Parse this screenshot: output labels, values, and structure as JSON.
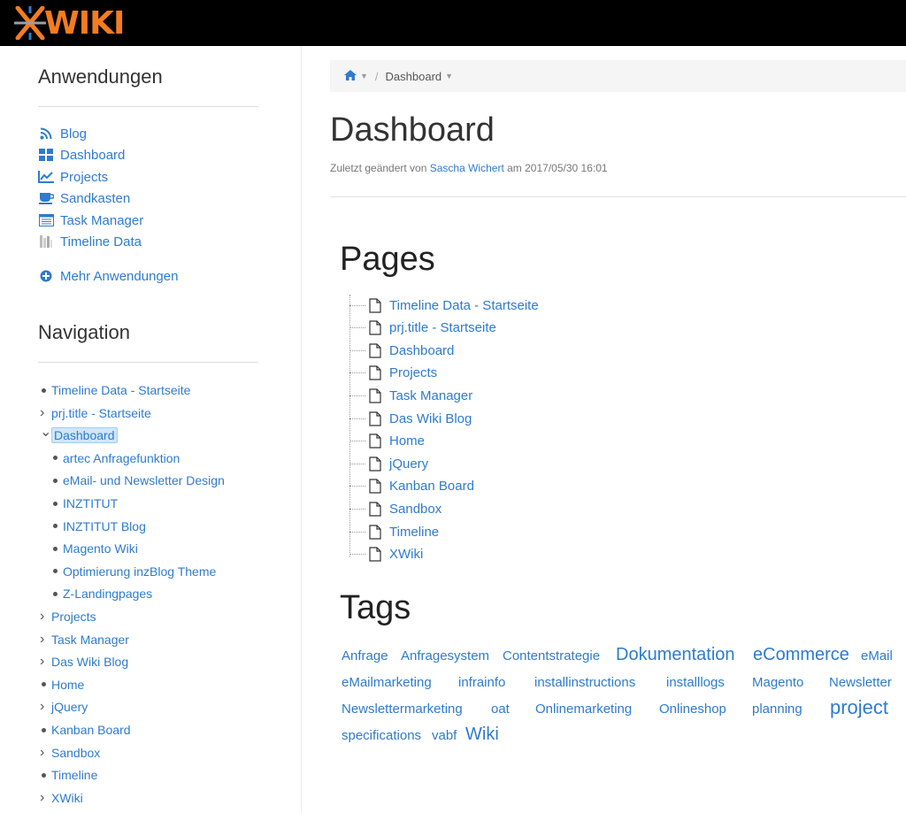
{
  "header": {
    "logo_text": "WIKI",
    "brand_color": "#f47c20"
  },
  "applications": {
    "title": "Anwendungen",
    "items": [
      {
        "label": "Blog",
        "icon": "rss-icon"
      },
      {
        "label": "Dashboard",
        "icon": "grid-icon"
      },
      {
        "label": "Projects",
        "icon": "line-chart-icon"
      },
      {
        "label": "Sandkasten",
        "icon": "coffee-cup-icon"
      },
      {
        "label": "Task Manager",
        "icon": "list-icon"
      },
      {
        "label": "Timeline Data",
        "icon": "timeline-icon"
      }
    ],
    "more_label": "Mehr Anwendungen"
  },
  "navigation": {
    "title": "Navigation",
    "items": [
      {
        "label": "Timeline Data - Startseite",
        "marker": "bullet",
        "level": 0
      },
      {
        "label": "prj.title - Startseite",
        "marker": "collapsed",
        "level": 0
      },
      {
        "label": "Dashboard",
        "marker": "expanded",
        "level": 0,
        "selected": true
      },
      {
        "label": "artec Anfragefunktion",
        "marker": "bullet",
        "level": 1
      },
      {
        "label": "eMail- und Newsletter Design",
        "marker": "bullet",
        "level": 1
      },
      {
        "label": "INZTITUT",
        "marker": "bullet",
        "level": 1
      },
      {
        "label": "INZTITUT Blog",
        "marker": "bullet",
        "level": 1
      },
      {
        "label": "Magento Wiki",
        "marker": "bullet",
        "level": 1
      },
      {
        "label": "Optimierung inzBlog Theme",
        "marker": "bullet",
        "level": 1
      },
      {
        "label": "Z-Landingpages",
        "marker": "bullet",
        "level": 1
      },
      {
        "label": "Projects",
        "marker": "collapsed",
        "level": 0
      },
      {
        "label": "Task Manager",
        "marker": "collapsed",
        "level": 0
      },
      {
        "label": "Das Wiki Blog",
        "marker": "collapsed",
        "level": 0
      },
      {
        "label": "Home",
        "marker": "bullet",
        "level": 0
      },
      {
        "label": "jQuery",
        "marker": "collapsed",
        "level": 0
      },
      {
        "label": "Kanban Board",
        "marker": "bullet",
        "level": 0
      },
      {
        "label": "Sandbox",
        "marker": "collapsed",
        "level": 0
      },
      {
        "label": "Timeline",
        "marker": "bullet",
        "level": 0
      },
      {
        "label": "XWiki",
        "marker": "collapsed",
        "level": 0
      }
    ]
  },
  "breadcrumb": {
    "current": "Dashboard"
  },
  "page": {
    "title": "Dashboard",
    "meta_prefix": "Zuletzt geändert von",
    "author": "Sascha Wichert",
    "meta_suffix": "am 2017/05/30 16:01"
  },
  "pages": {
    "title": "Pages",
    "items": [
      "Timeline Data - Startseite",
      "prj.title - Startseite",
      "Dashboard",
      "Projects",
      "Task Manager",
      "Das Wiki Blog",
      "Home",
      "jQuery",
      "Kanban Board",
      "Sandbox",
      "Timeline",
      "XWiki"
    ]
  },
  "tags": {
    "title": "Tags",
    "rows": [
      [
        {
          "label": "Anfrage",
          "weight": 1
        },
        {
          "label": "Anfragesystem",
          "weight": 1
        },
        {
          "label": "Contentstrategie",
          "weight": 1
        },
        {
          "label": "Dokumentation",
          "weight": 3
        },
        {
          "label": "eCommerce",
          "weight": 3
        },
        {
          "label": "eMail",
          "weight": 1
        }
      ],
      [
        {
          "label": "eMailmarketing",
          "weight": 1
        },
        {
          "label": "infrainfo",
          "weight": 1
        },
        {
          "label": "installinstructions",
          "weight": 1
        },
        {
          "label": "installlogs",
          "weight": 1
        },
        {
          "label": "Magento",
          "weight": 1
        },
        {
          "label": "Newsletter",
          "weight": 1
        }
      ],
      [
        {
          "label": "Newslettermarketing",
          "weight": 1
        },
        {
          "label": "oat",
          "weight": 1
        },
        {
          "label": "Onlinemarketing",
          "weight": 1
        },
        {
          "label": "Onlineshop",
          "weight": 1
        },
        {
          "label": "planning",
          "weight": 1
        },
        {
          "label": "project",
          "weight": 4
        }
      ],
      [
        {
          "label": "specifications",
          "weight": 1
        },
        {
          "label": "vabf",
          "weight": 1
        },
        {
          "label": "Wiki",
          "weight": 3
        }
      ]
    ]
  },
  "colors": {
    "link": "#2e7bcf",
    "selected_bg": "#cfe6fb"
  }
}
